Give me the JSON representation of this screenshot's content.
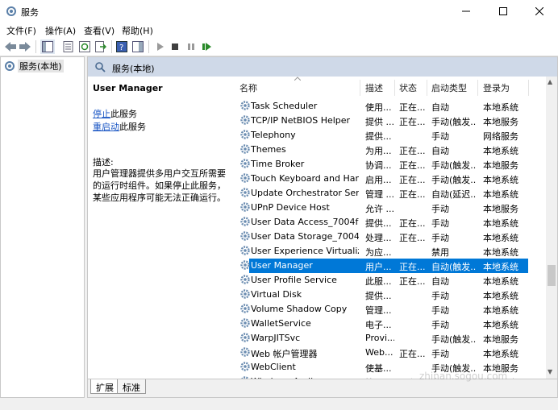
{
  "window": {
    "title": "服务"
  },
  "menu": [
    "文件(F)",
    "操作(A)",
    "查看(V)",
    "帮助(H)"
  ],
  "tree": {
    "root": "服务(本地)"
  },
  "pane_header": "服务(本地)",
  "details": {
    "service_name": "User Manager",
    "stop_link": "停止",
    "stop_suffix": "此服务",
    "restart_link": "重启动",
    "restart_suffix": "此服务",
    "desc_label": "描述:",
    "description": "用户管理器提供多用户交互所需要的运行时组件。如果停止此服务，某些应用程序可能无法正确运行。"
  },
  "columns": {
    "name": "名称",
    "desc": "描述",
    "status": "状态",
    "startup": "启动类型",
    "logon": "登录为"
  },
  "rows": [
    {
      "name": "Task Scheduler",
      "desc": "使用...",
      "status": "正在...",
      "startup": "自动",
      "logon": "本地系统"
    },
    {
      "name": "TCP/IP NetBIOS Helper",
      "desc": "提供 ...",
      "status": "正在...",
      "startup": "手动(触发...",
      "logon": "本地服务"
    },
    {
      "name": "Telephony",
      "desc": "提供...",
      "status": "",
      "startup": "手动",
      "logon": "网络服务"
    },
    {
      "name": "Themes",
      "desc": "为用...",
      "status": "正在...",
      "startup": "自动",
      "logon": "本地系统"
    },
    {
      "name": "Time Broker",
      "desc": "协调...",
      "status": "正在...",
      "startup": "手动(触发...",
      "logon": "本地服务"
    },
    {
      "name": "Touch Keyboard and Hand...",
      "desc": "启用...",
      "status": "正在...",
      "startup": "手动(触发...",
      "logon": "本地系统"
    },
    {
      "name": "Update Orchestrator Service",
      "desc": "管理 ...",
      "status": "正在...",
      "startup": "自动(延迟...",
      "logon": "本地系统"
    },
    {
      "name": "UPnP Device Host",
      "desc": "允许 ...",
      "status": "",
      "startup": "手动",
      "logon": "本地服务"
    },
    {
      "name": "User Data Access_7004f24",
      "desc": "提供...",
      "status": "正在...",
      "startup": "手动",
      "logon": "本地系统"
    },
    {
      "name": "User Data Storage_7004f24",
      "desc": "处理...",
      "status": "正在...",
      "startup": "手动",
      "logon": "本地系统"
    },
    {
      "name": "User Experience Virtualizat...",
      "desc": "为应...",
      "status": "",
      "startup": "禁用",
      "logon": "本地系统"
    },
    {
      "name": "User Manager",
      "desc": "用户...",
      "status": "正在...",
      "startup": "自动(触发...",
      "logon": "本地系统"
    },
    {
      "name": "User Profile Service",
      "desc": "此服...",
      "status": "正在...",
      "startup": "自动",
      "logon": "本地系统"
    },
    {
      "name": "Virtual Disk",
      "desc": "提供...",
      "status": "",
      "startup": "手动",
      "logon": "本地系统"
    },
    {
      "name": "Volume Shadow Copy",
      "desc": "管理...",
      "status": "",
      "startup": "手动",
      "logon": "本地系统"
    },
    {
      "name": "WalletService",
      "desc": "电子...",
      "status": "",
      "startup": "手动",
      "logon": "本地系统"
    },
    {
      "name": "WarpJITSvc",
      "desc": "Provi...",
      "status": "",
      "startup": "手动(触发...",
      "logon": "本地服务"
    },
    {
      "name": "Web 帐户管理器",
      "desc": "Web...",
      "status": "正在...",
      "startup": "手动",
      "logon": "本地系统"
    },
    {
      "name": "WebClient",
      "desc": "使基...",
      "status": "",
      "startup": "手动(触发...",
      "logon": "本地服务"
    },
    {
      "name": "Windows Audio",
      "desc": "管理...",
      "status": "正在...",
      "startup": "自动",
      "logon": "本地服务"
    }
  ],
  "tabs": [
    "扩展",
    "标准"
  ],
  "watermark": "zhinan.sogou.com",
  "colors": {
    "selection": "#0078d7",
    "header": "#cfd9e8",
    "link": "#1a56c4"
  }
}
